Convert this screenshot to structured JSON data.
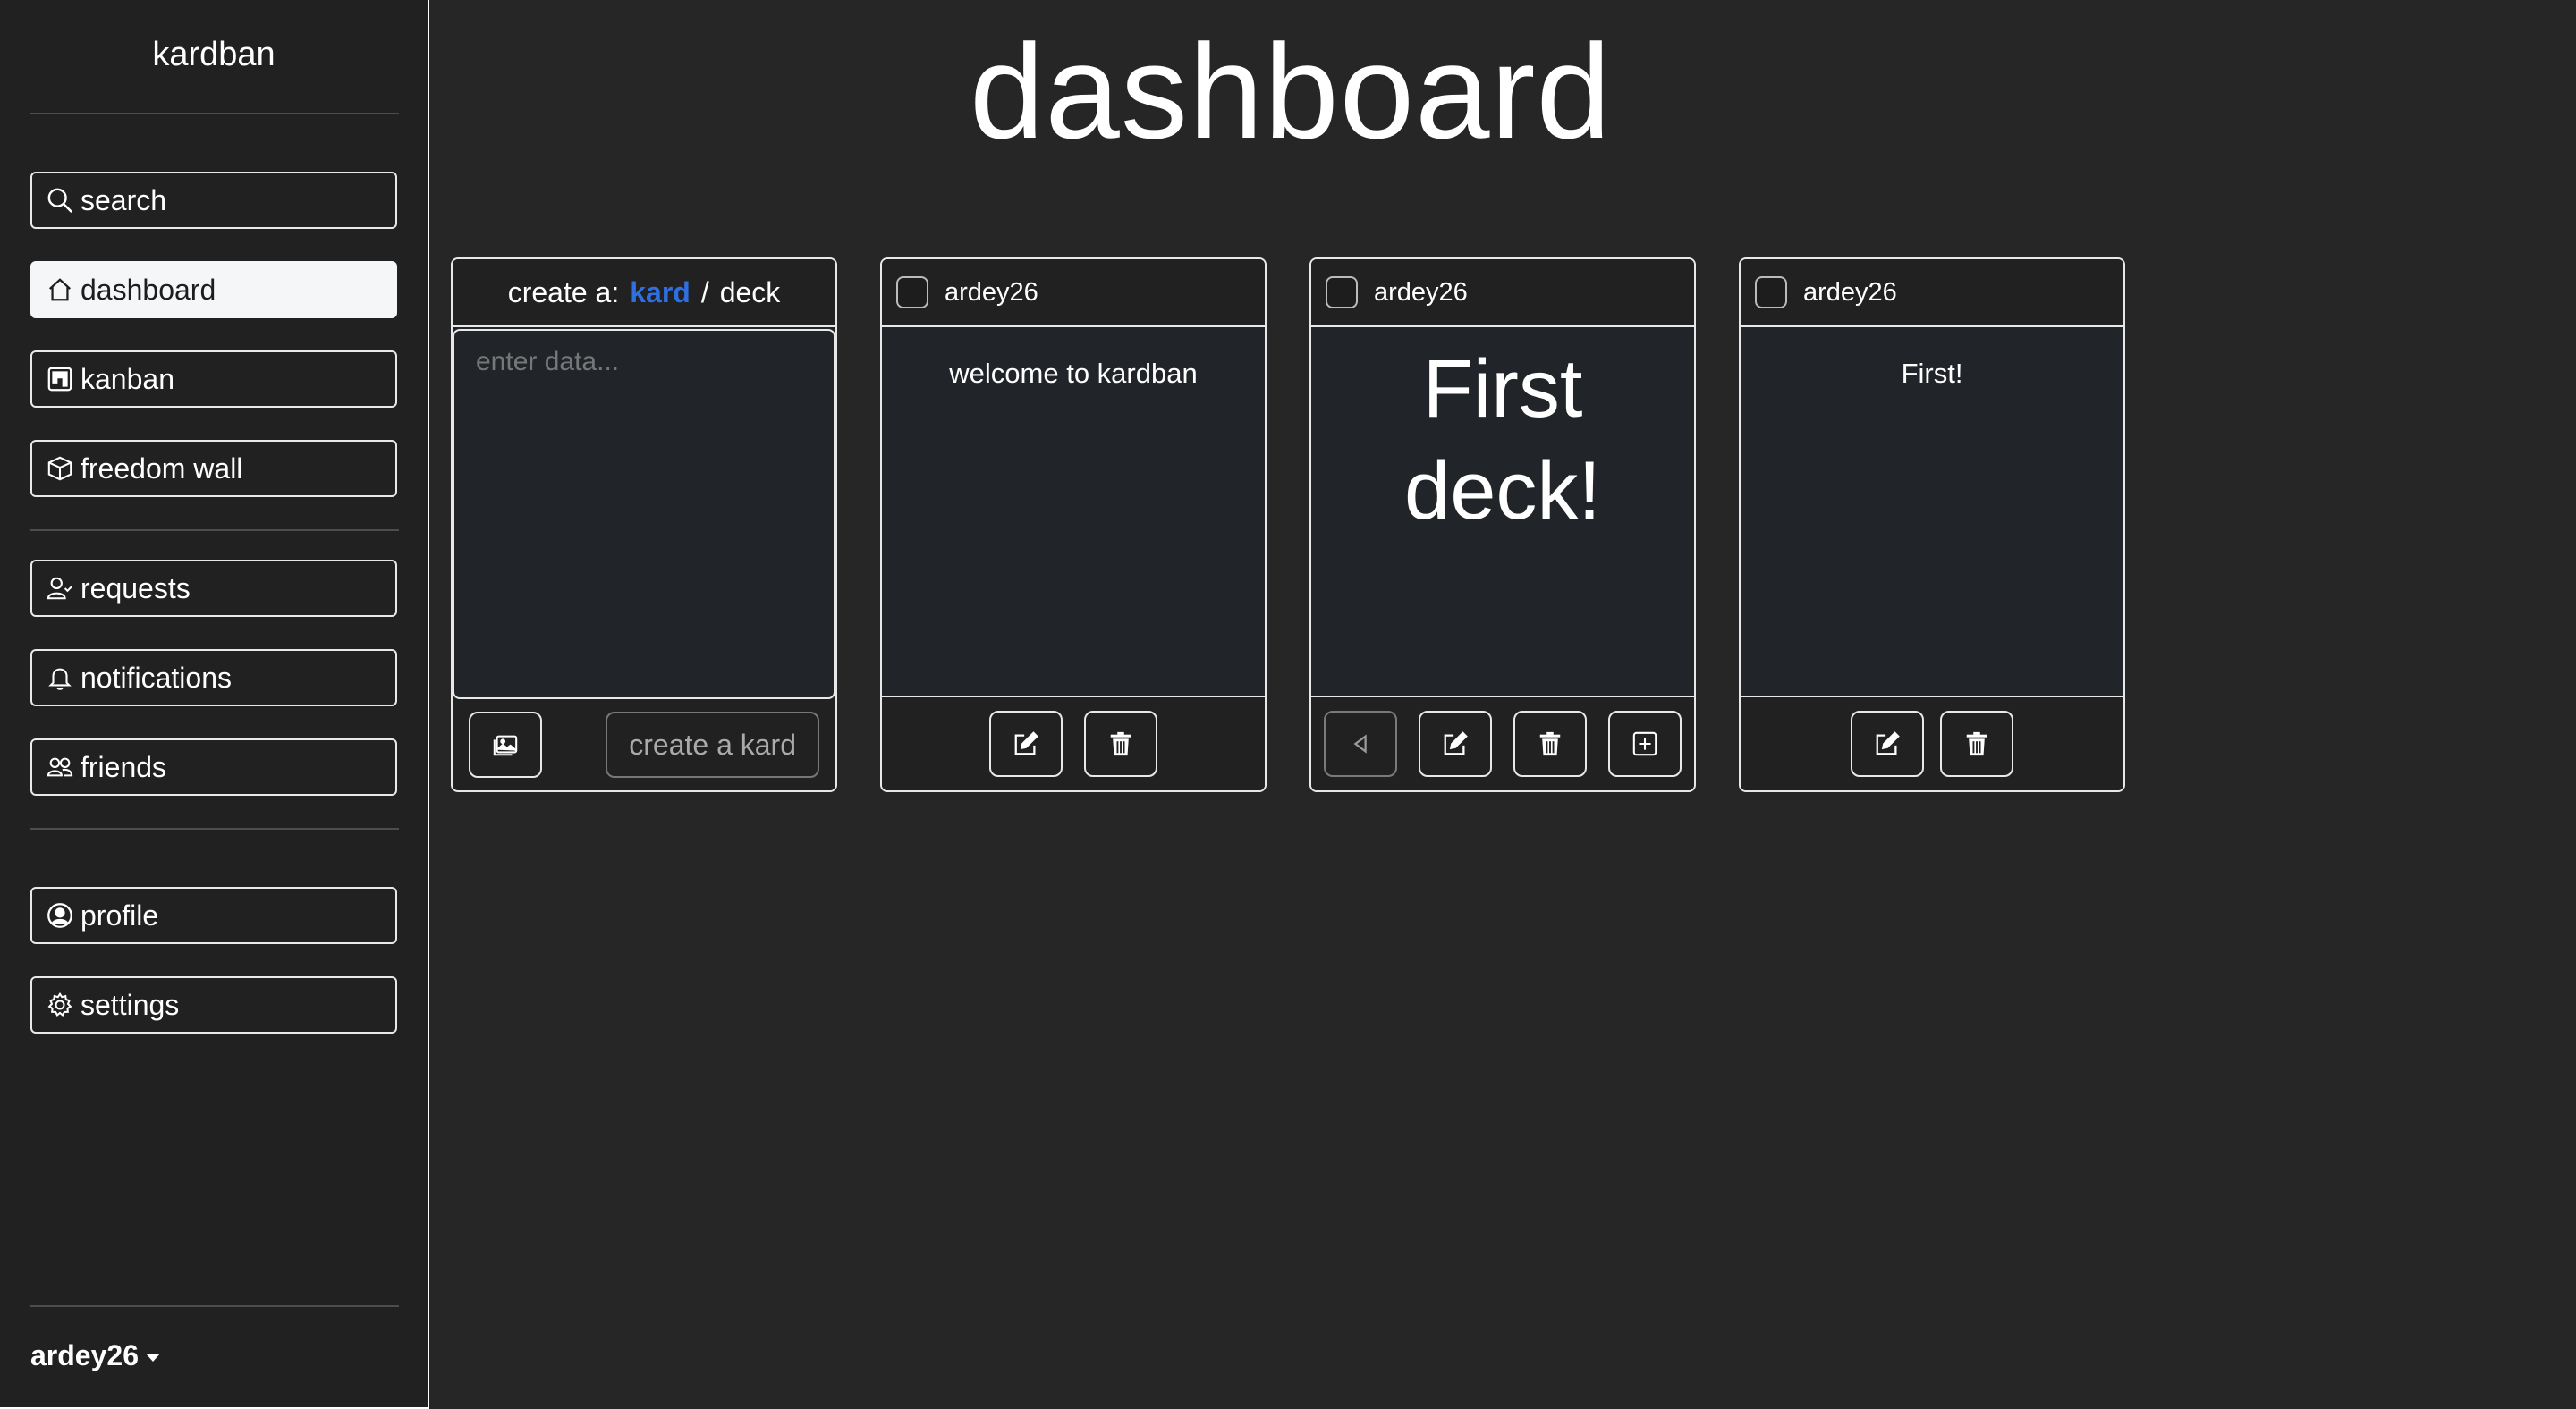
{
  "sidebar": {
    "brand": "kardban",
    "nav": [
      {
        "label": "search",
        "icon": "search-icon"
      },
      {
        "label": "dashboard",
        "icon": "home-icon",
        "active": true
      },
      {
        "label": "kanban",
        "icon": "kanban-icon"
      },
      {
        "label": "freedom wall",
        "icon": "box-icon"
      },
      {
        "label": "requests",
        "icon": "person-check-icon"
      },
      {
        "label": "notifications",
        "icon": "bell-icon"
      },
      {
        "label": "friends",
        "icon": "people-icon"
      },
      {
        "label": "profile",
        "icon": "person-circle-icon"
      },
      {
        "label": "settings",
        "icon": "gear-icon"
      }
    ],
    "user": "ardey26"
  },
  "main": {
    "title": "dashboard",
    "create": {
      "prefix": "create a:",
      "option_kard": "kard",
      "separator": "/",
      "option_deck": "deck",
      "placeholder": "enter data...",
      "submit_label": "create a kard"
    },
    "cards": [
      {
        "author": "ardey26",
        "content": "welcome to kardban",
        "type": "kard"
      },
      {
        "author": "ardey26",
        "content": "First deck!",
        "type": "deck"
      },
      {
        "author": "ardey26",
        "content": "First!",
        "type": "kard"
      }
    ]
  },
  "colors": {
    "background": "#262626",
    "sidebar": "#212121",
    "card": "#212529",
    "accent": "#2f6fe0",
    "active_nav": "#f5f6f8"
  }
}
